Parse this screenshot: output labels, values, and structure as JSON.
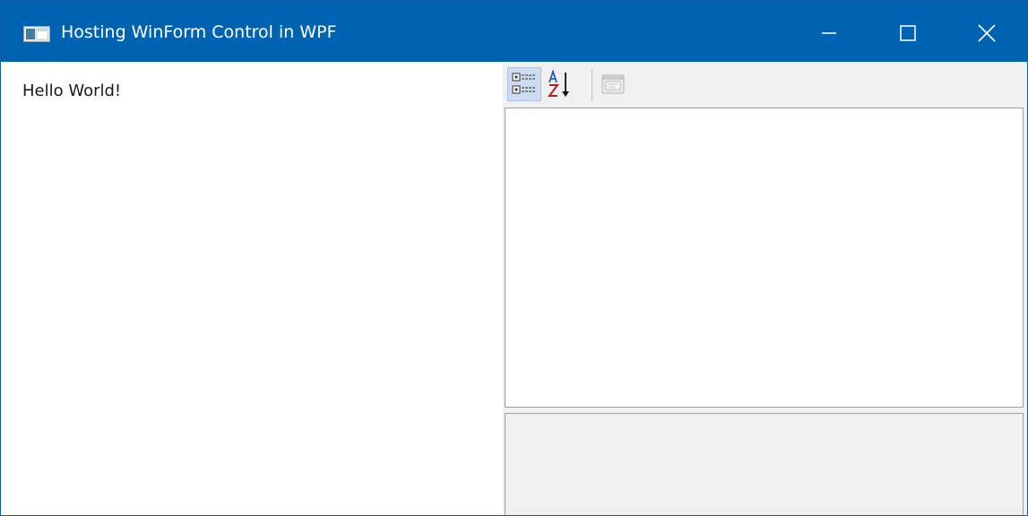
{
  "window": {
    "title": "Hosting WinForm Control in WPF",
    "icon": "window-app-icon",
    "caption_buttons": [
      "minimize-icon",
      "maximize-icon",
      "close-icon"
    ],
    "titlebar_color": "#0063b1"
  },
  "content": {
    "label_text": "Hello World!"
  },
  "property_grid": {
    "toolbar_buttons": [
      "categorized-icon",
      "alphabetical-sort-icon",
      "property-pages-icon"
    ],
    "categorized_selected": true,
    "property_pages_enabled": false
  }
}
